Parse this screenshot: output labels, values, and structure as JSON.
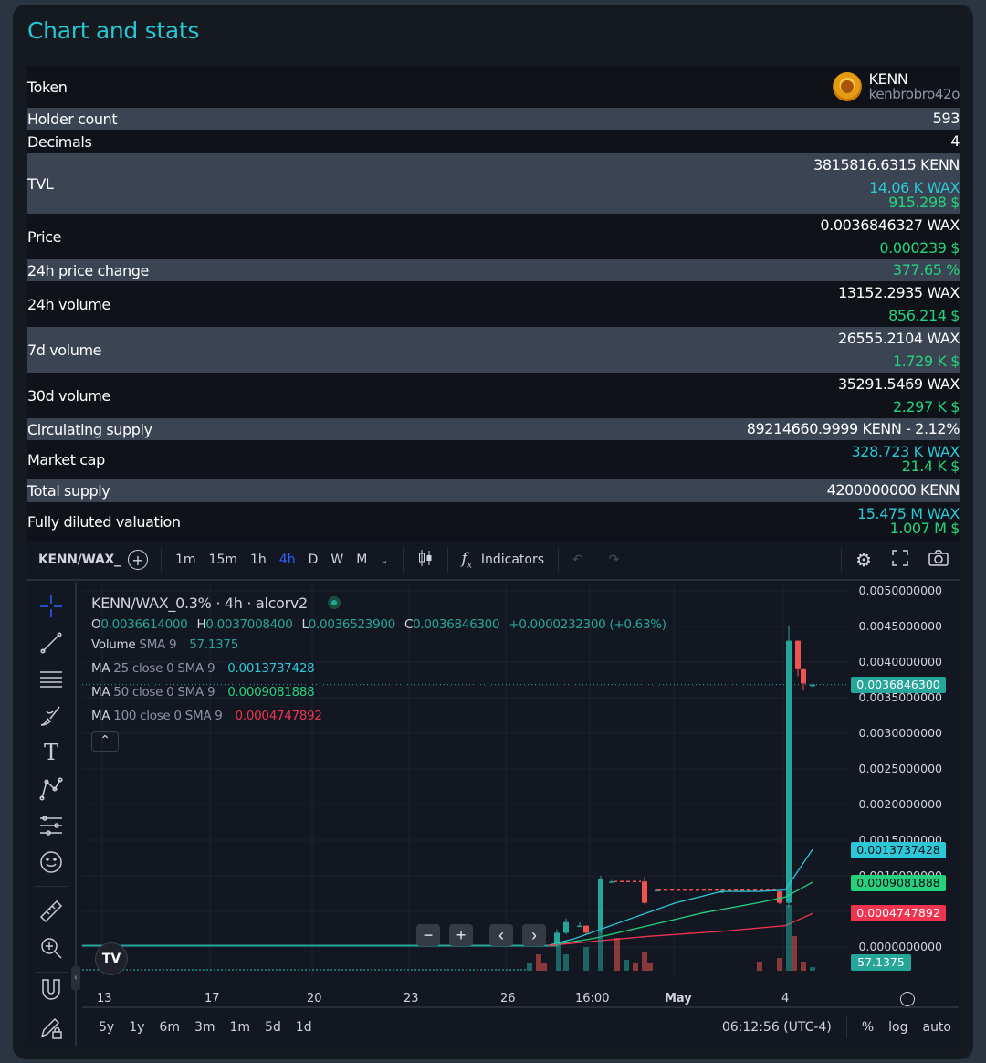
{
  "title": "Chart and stats",
  "stats": {
    "token": {
      "label": "Token",
      "name": "KENN",
      "contract": "kenbrobro42o"
    },
    "holder_count": {
      "label": "Holder count",
      "value": "593"
    },
    "decimals": {
      "label": "Decimals",
      "value": "4"
    },
    "tvl": {
      "label": "TVL",
      "v1": "3815816.6315 KENN",
      "v2": "14.06 K WAX",
      "v3": "915.298 $"
    },
    "price": {
      "label": "Price",
      "v1": "0.0036846327 WAX",
      "v2": "0.000239 $"
    },
    "change_24h": {
      "label": "24h price change",
      "value": "377.65 %"
    },
    "volume_24h": {
      "label": "24h volume",
      "v1": "13152.2935 WAX",
      "v2": "856.214 $"
    },
    "volume_7d": {
      "label": "7d volume",
      "v1": "26555.2104 WAX",
      "v2": "1.729 K $"
    },
    "volume_30d": {
      "label": "30d volume",
      "v1": "35291.5469 WAX",
      "v2": "2.297 K $"
    },
    "circulating": {
      "label": "Circulating supply",
      "value": "89214660.9999 KENN - 2.12%"
    },
    "market_cap": {
      "label": "Market cap",
      "v1": "328.723 K WAX",
      "v2": "21.4 K $"
    },
    "total_supply": {
      "label": "Total supply",
      "value": "4200000000 KENN"
    },
    "fdv": {
      "label": "Fully diluted valuation",
      "v1": "15.475 M WAX",
      "v2": "1.007 M $"
    }
  },
  "toolbar": {
    "symbol": "KENN/WAX_",
    "intervals": [
      "1m",
      "15m",
      "1h",
      "4h",
      "D",
      "W",
      "M"
    ],
    "active_interval": "4h",
    "indicators_label": "Indicators"
  },
  "legend": {
    "title": "KENN/WAX_0.3% · 4h · alcorv2",
    "o_label": "O",
    "o": "0.0036614000",
    "h_label": "H",
    "h": "0.0037008400",
    "l_label": "L",
    "l": "0.0036523900",
    "c_label": "C",
    "c": "0.0036846300",
    "change": "+0.0000232300 (+0.63%)",
    "volume_label": "Volume",
    "volume_sma": "SMA 9",
    "volume_value": "57.1375",
    "ma25_label": "MA",
    "ma25_params": "25 close 0 SMA 9",
    "ma25_value": "0.0013737428",
    "ma50_label": "MA",
    "ma50_params": "50 close 0 SMA 9",
    "ma50_value": "0.0009081888",
    "ma100_label": "MA",
    "ma100_params": "100 close 0 SMA 9",
    "ma100_value": "0.0004747892"
  },
  "price_axis": [
    "0.0050000000",
    "0.0045000000",
    "0.0040000000",
    "0.0035000000",
    "0.0030000000",
    "0.0025000000",
    "0.0020000000",
    "0.0015000000",
    "0.0010000000",
    "0.0000000000"
  ],
  "price_tags": {
    "last": "0.0036846300",
    "ma25": "0.0013737428",
    "ma50": "0.0009081888",
    "ma100": "0.0004747892",
    "volume": "57.1375"
  },
  "time_axis": [
    "13",
    "17",
    "20",
    "23",
    "26",
    "16:00",
    "May",
    "4"
  ],
  "bottom": {
    "ranges": [
      "5y",
      "1y",
      "6m",
      "3m",
      "1m",
      "5d",
      "1d"
    ],
    "clock": "06:12:56 (UTC-4)",
    "percent": "%",
    "log": "log",
    "auto": "auto"
  },
  "colors": {
    "accent": "#27c6d3",
    "up": "#26a69a",
    "down": "#ef5350",
    "ma25": "#2cc8d8",
    "ma50": "#26d07c",
    "ma100": "#f0344f"
  }
}
